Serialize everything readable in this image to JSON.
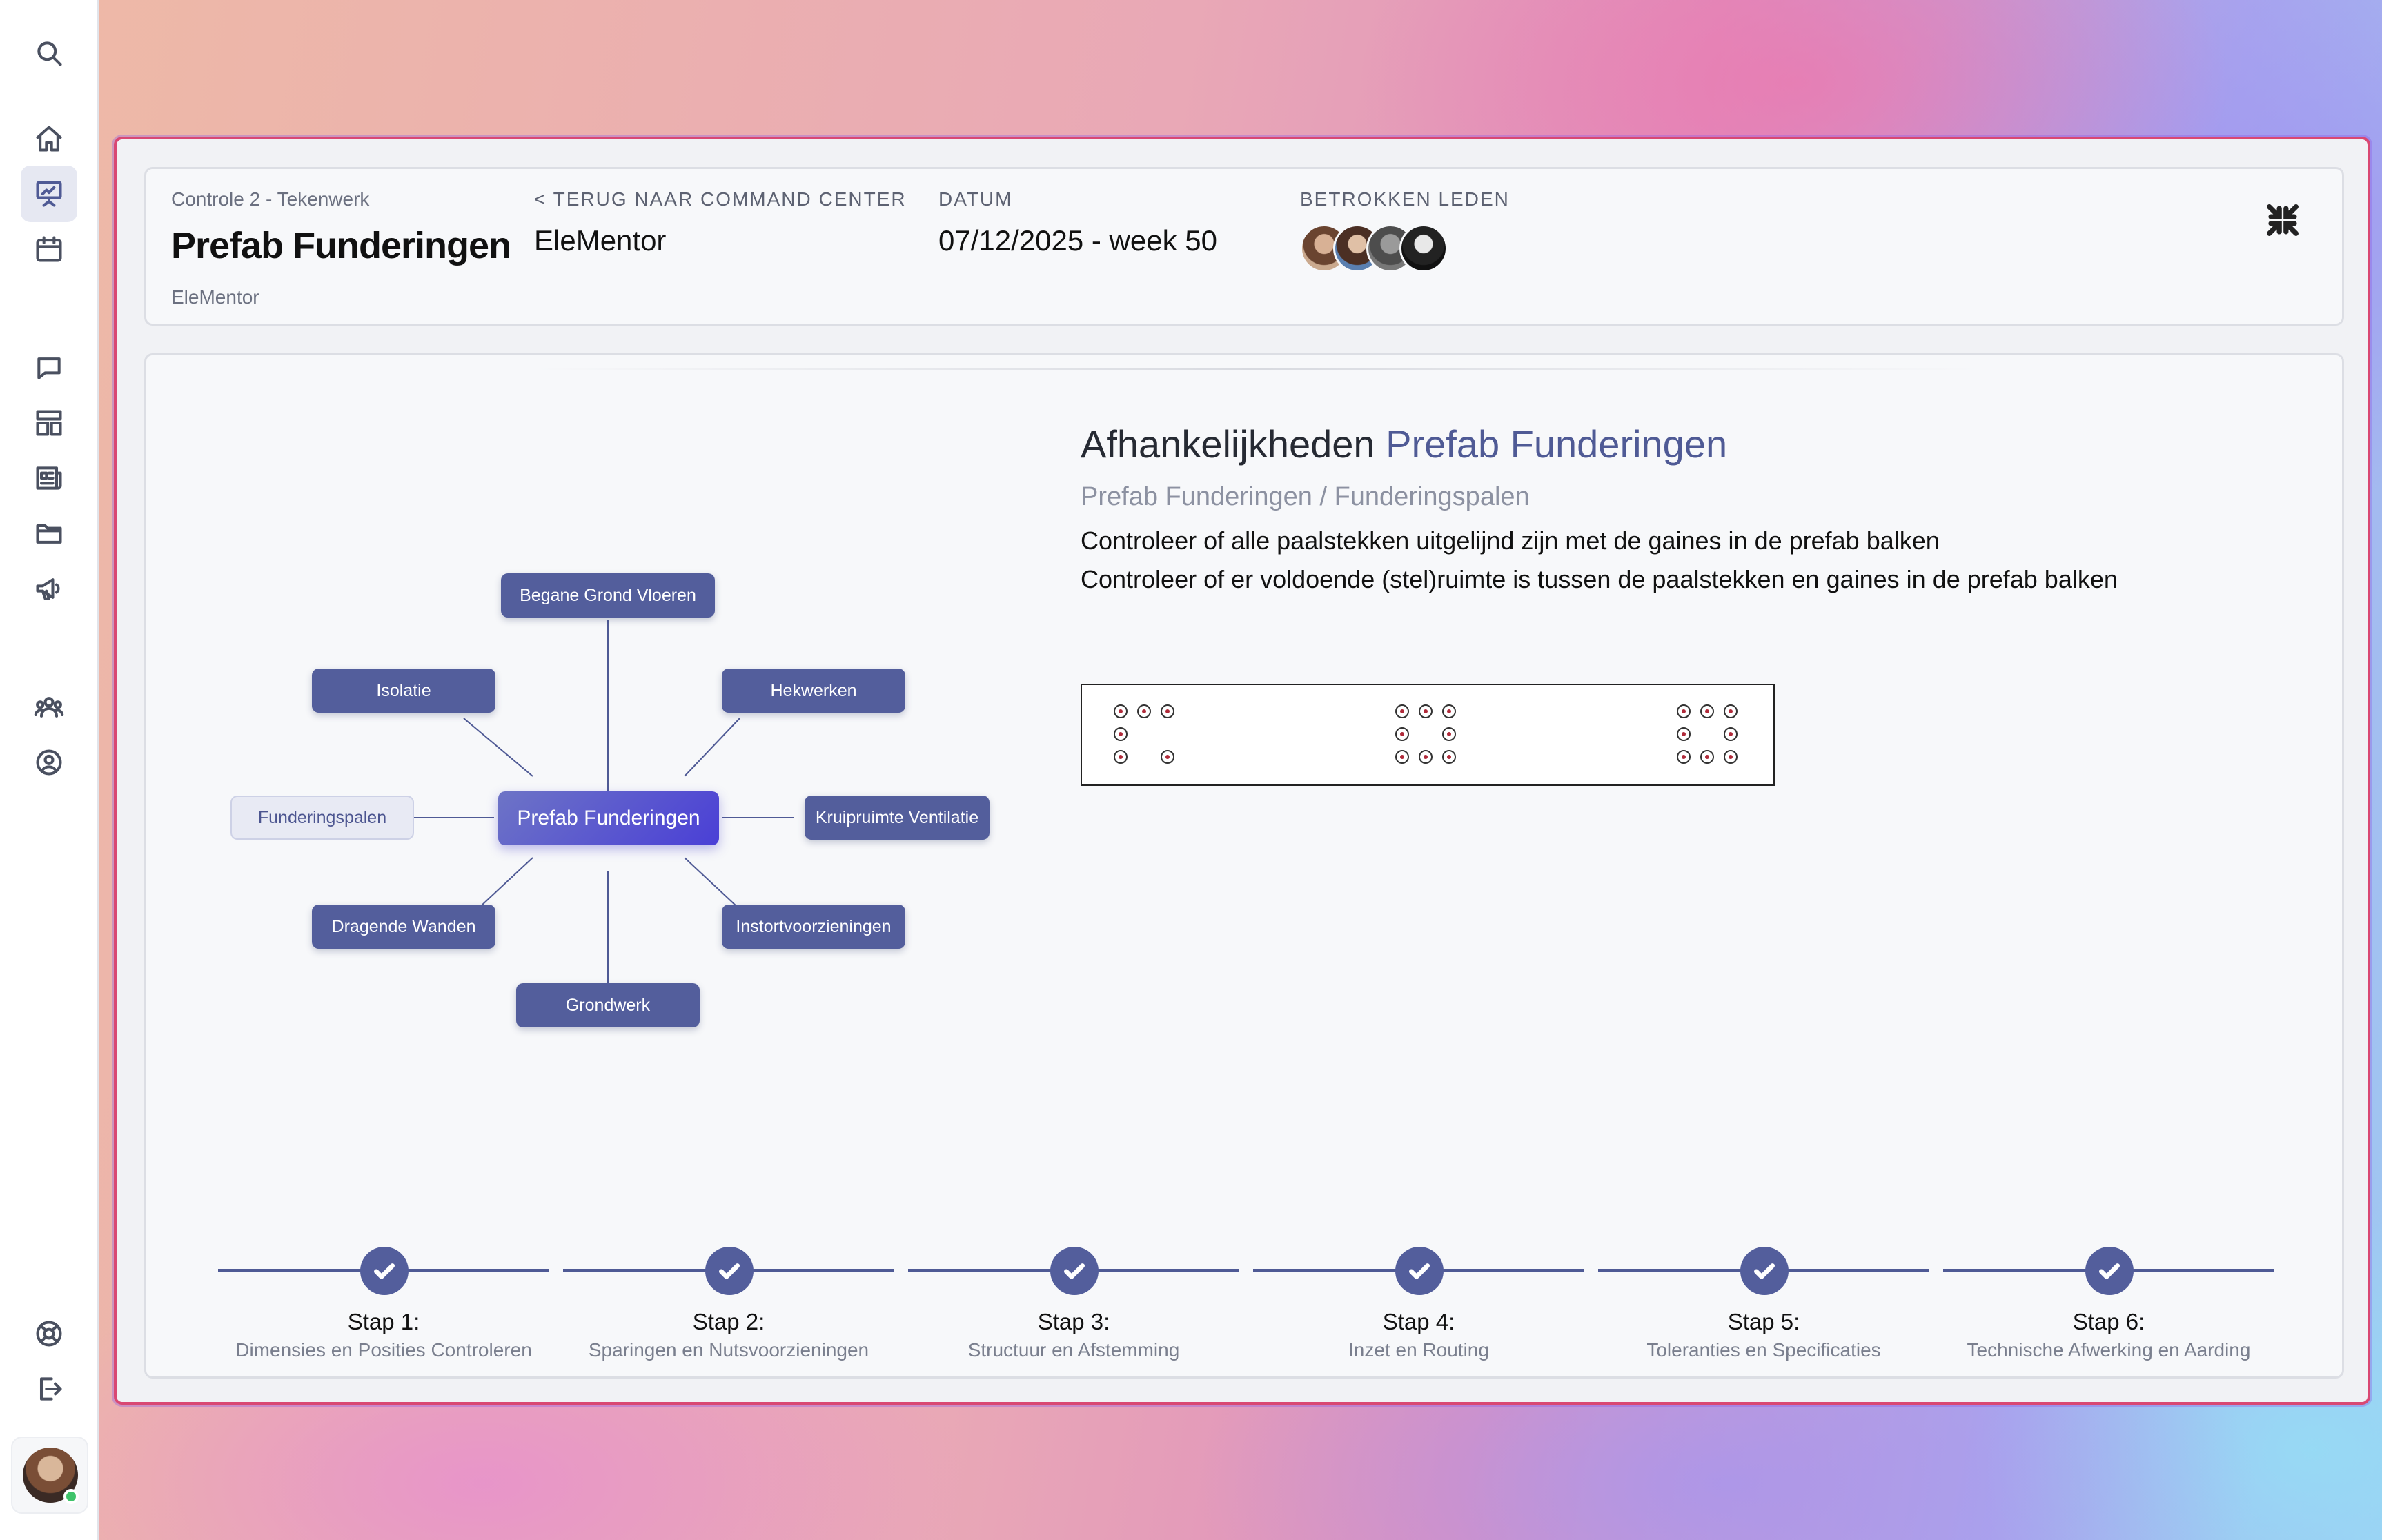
{
  "sidebar": {
    "icons": [
      "search-icon",
      "home-icon",
      "presentation-icon",
      "calendar-icon",
      "chat-icon",
      "layout-icon",
      "newspaper-icon",
      "folder-icon",
      "megaphone-icon",
      "team-icon",
      "user-circle-icon",
      "support-icon",
      "logout-icon"
    ],
    "active": "presentation-icon",
    "online_color": "#3fc36a"
  },
  "header": {
    "breadcrumb": "Controle 2 - Tekenwerk",
    "title": "Prefab Funderingen",
    "subtitle": "EleMentor",
    "back_label": "< TERUG NAAR COMMAND CENTER",
    "back_value": "EleMentor",
    "date_label": "DATUM",
    "date_value": "07/12/2025 - week 50",
    "members_label": "BETROKKEN LEDEN",
    "member_count": 4
  },
  "mindmap": {
    "center": "Prefab Funderingen",
    "nodes": {
      "top": "Begane Grond Vloeren",
      "top_left": "Isolatie",
      "top_right": "Hekwerken",
      "left": "Funderingspalen",
      "right": "Kruipruimte Ventilatie",
      "bottom_left": "Dragende Wanden",
      "bottom_right": "Instortvoorzieningen",
      "bottom": "Grondwerk"
    },
    "highlighted": "Funderingspalen"
  },
  "detail": {
    "title_prefix": "Afhankelijkheden",
    "title_accent": "Prefab Funderingen",
    "path": "Prefab Funderingen / Funderingspalen",
    "checks": [
      "Controleer of alle paalstekken uitgelijnd zijn met de gaines in de prefab balken",
      "Controleer of er voldoende (stel)ruimte is tussen de paalstekken en gaines in de prefab balken"
    ]
  },
  "steps": [
    {
      "label": "Stap 1:",
      "desc": "Dimensies en Posities Controleren",
      "done": true
    },
    {
      "label": "Stap 2:",
      "desc": "Sparingen en Nutsvoorzieningen",
      "done": true
    },
    {
      "label": "Stap 3:",
      "desc": "Structuur en Afstemming",
      "done": true
    },
    {
      "label": "Stap 4:",
      "desc": "Inzet en Routing",
      "done": true
    },
    {
      "label": "Stap 5:",
      "desc": "Toleranties en Specificaties",
      "done": true
    },
    {
      "label": "Stap 6:",
      "desc": "Technische Afwerking en Aarding",
      "done": true
    }
  ],
  "colors": {
    "accent": "#4f5a95",
    "frame": "#d94873"
  }
}
